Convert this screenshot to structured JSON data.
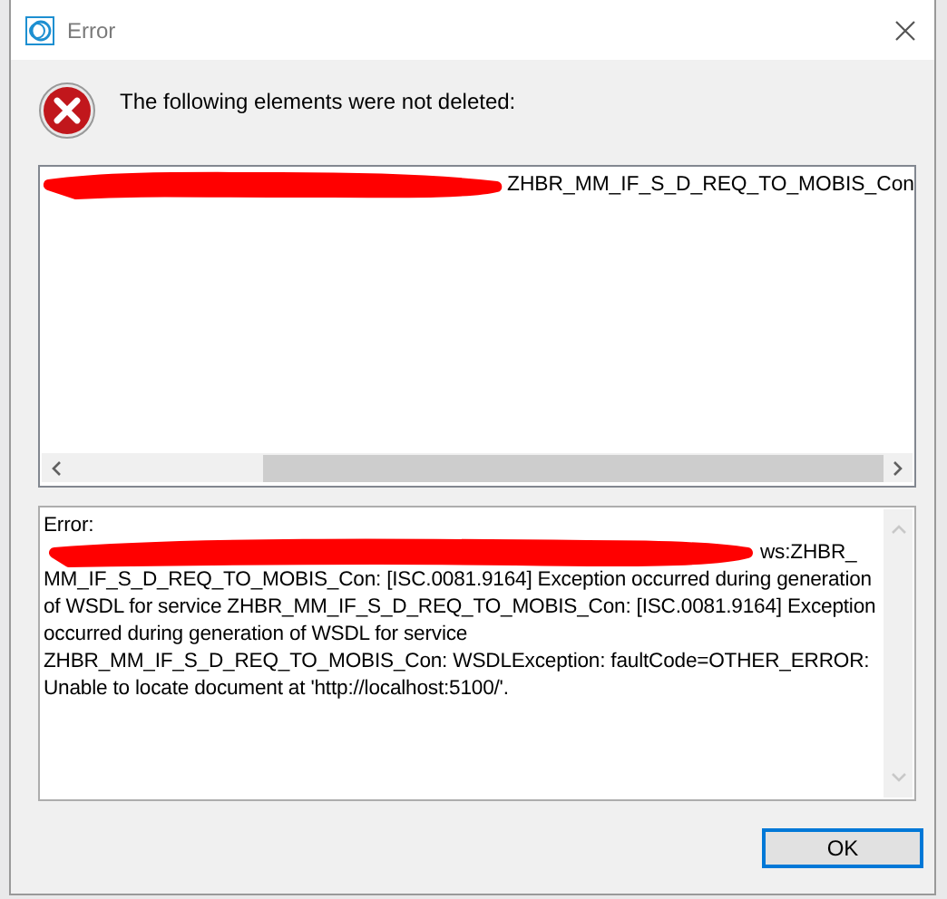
{
  "window": {
    "title": "Error"
  },
  "message": "The following elements were not deleted:",
  "elements": [
    {
      "redacted": true,
      "text": "ZHBR_MM_IF_S_D_REQ_TO_MOBIS_Con"
    }
  ],
  "details": [
    {
      "redacted": false,
      "text": "Error:"
    },
    {
      "redacted": true,
      "text": "ws:ZHBR_"
    },
    {
      "redacted": false,
      "text": "MM_IF_S_D_REQ_TO_MOBIS_Con: [ISC.0081.9164] Exception occurred during generation"
    },
    {
      "redacted": false,
      "text": "of WSDL for service ZHBR_MM_IF_S_D_REQ_TO_MOBIS_Con: [ISC.0081.9164] Exception"
    },
    {
      "redacted": false,
      "text": "occurred during generation of WSDL for service"
    },
    {
      "redacted": false,
      "text": "ZHBR_MM_IF_S_D_REQ_TO_MOBIS_Con: WSDLException: faultCode=OTHER_ERROR:"
    },
    {
      "redacted": false,
      "text": "Unable to locate document at 'http://localhost:5100/'."
    }
  ],
  "buttons": [
    {
      "label": "OK",
      "selected": true
    }
  ]
}
